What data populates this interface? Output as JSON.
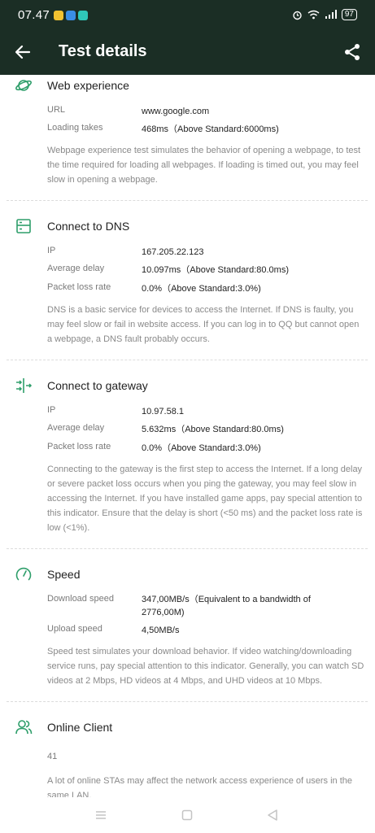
{
  "status_bar": {
    "time": "07.47",
    "battery": "97"
  },
  "app_bar": {
    "title": "Test details"
  },
  "sections": {
    "web": {
      "title": "Web experience",
      "rows": [
        {
          "label": "URL",
          "value": "www.google.com"
        },
        {
          "label": "Loading takes",
          "value": "468ms（Above Standard:6000ms)"
        }
      ],
      "description": "Webpage experience test simulates the behavior of opening a webpage, to test the time required for loading all webpages. If loading is timed out, you may feel slow in opening a webpage."
    },
    "dns": {
      "title": "Connect to DNS",
      "rows": [
        {
          "label": "IP",
          "value": "167.205.22.123"
        },
        {
          "label": "Average delay",
          "value": "10.097ms（Above Standard:80.0ms)"
        },
        {
          "label": "Packet loss rate",
          "value": "0.0%（Above Standard:3.0%)"
        }
      ],
      "description": "DNS is a basic service for devices to access the Internet. If DNS is faulty, you may feel slow or fail in website access. If you can log in to QQ but cannot open a webpage, a DNS fault probably occurs."
    },
    "gateway": {
      "title": "Connect to gateway",
      "rows": [
        {
          "label": "IP",
          "value": "10.97.58.1"
        },
        {
          "label": "Average delay",
          "value": "5.632ms（Above Standard:80.0ms)"
        },
        {
          "label": "Packet loss rate",
          "value": "0.0%（Above Standard:3.0%)"
        }
      ],
      "description": "Connecting to the gateway is the first step to access the Internet. If a long delay or severe packet loss occurs when you ping the gateway, you may feel slow in accessing the Internet. If you have installed game apps, pay special attention to this indicator. Ensure that the delay is short (<50 ms) and the packet loss rate is low (<1%)."
    },
    "speed": {
      "title": "Speed",
      "rows": [
        {
          "label": "Download speed",
          "value": "347,00MB/s（Equivalent to a bandwidth of 2776,00M)"
        },
        {
          "label": "Upload speed",
          "value": "4,50MB/s"
        }
      ],
      "description": "Speed test simulates your download behavior. If video watching/downloading service runs, pay special attention to this indicator. Generally, you can watch SD videos at 2 Mbps, HD videos at 4 Mbps, and UHD videos at 10 Mbps."
    },
    "clients": {
      "title": "Online Client",
      "count": "41",
      "description": "A lot of online STAs may affect the network access experience of users in the same LAN."
    }
  },
  "colors": {
    "header_bg": "#1b2e25",
    "accent_icon": "#2e9e6a"
  },
  "icons": {
    "web": "planet-icon",
    "dns": "server-icon",
    "gateway": "gateway-arrows-icon",
    "speed": "speedometer-icon",
    "clients": "users-icon"
  }
}
